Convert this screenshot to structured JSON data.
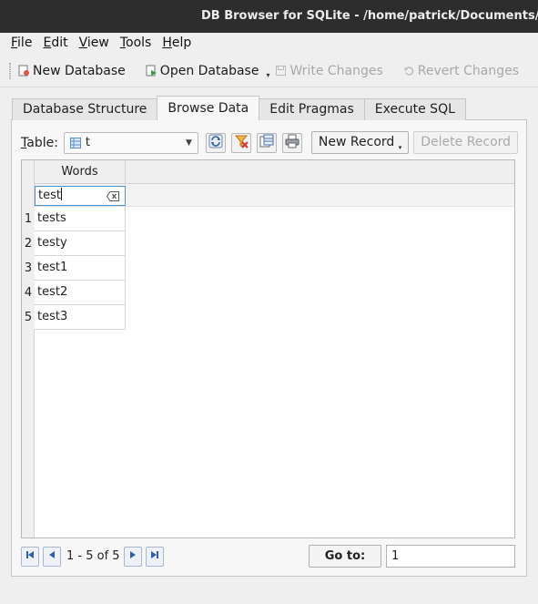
{
  "window": {
    "title": "DB Browser for SQLite - /home/patrick/Documents/C"
  },
  "menu": [
    {
      "u": "F",
      "rest": "ile"
    },
    {
      "u": "E",
      "rest": "dit"
    },
    {
      "u": "V",
      "rest": "iew"
    },
    {
      "u": "T",
      "rest": "ools"
    },
    {
      "u": "H",
      "rest": "elp"
    }
  ],
  "toolbar": {
    "new_db": "New Database",
    "open_db": "Open Database",
    "write": "Write Changes",
    "revert": "Revert Changes"
  },
  "tabs": [
    "Database Structure",
    "Browse Data",
    "Edit Pragmas",
    "Execute SQL"
  ],
  "browse": {
    "table_label_u": "T",
    "table_label_rest": "able:",
    "table_value": "t",
    "new_record": "New Record",
    "delete_record": "Delete Record",
    "column_header": "Words",
    "filter_value": "test",
    "rows": [
      {
        "num": "1",
        "value": "tests"
      },
      {
        "num": "2",
        "value": "testy"
      },
      {
        "num": "3",
        "value": "test1"
      },
      {
        "num": "4",
        "value": "test2"
      },
      {
        "num": "5",
        "value": "test3"
      }
    ],
    "record_range": "1 - 5 of 5",
    "goto_label": "Go to:",
    "goto_value": "1"
  },
  "colors": {
    "titlebar": "#2d2d2d",
    "accent": "#4a90d9"
  }
}
